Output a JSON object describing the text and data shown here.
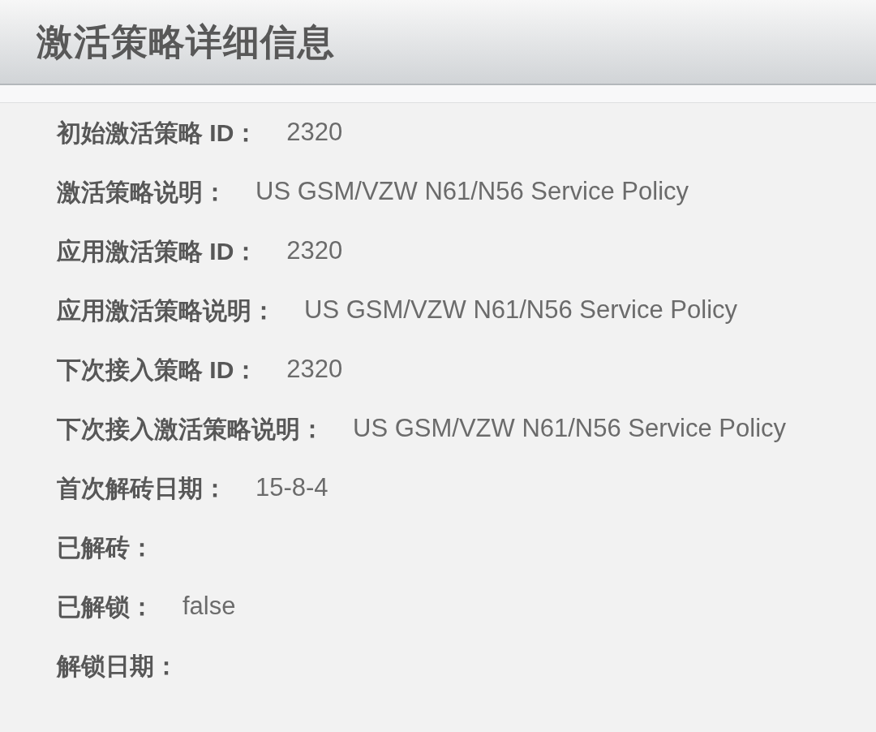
{
  "title": "激活策略详细信息",
  "fields": [
    {
      "label": "初始激活策略 ID：",
      "value": "2320"
    },
    {
      "label": "激活策略说明：",
      "value": "US GSM/VZW N61/N56 Service Policy"
    },
    {
      "label": "应用激活策略 ID：",
      "value": "2320"
    },
    {
      "label": "应用激活策略说明：",
      "value": "US GSM/VZW N61/N56 Service Policy"
    },
    {
      "label": "下次接入策略 ID：",
      "value": "2320"
    },
    {
      "label": "下次接入激活策略说明：",
      "value": "US GSM/VZW N61/N56 Service Policy"
    },
    {
      "label": "首次解砖日期：",
      "value": "15-8-4"
    },
    {
      "label": "已解砖："
    },
    {
      "label": "已解锁：",
      "value": "false"
    },
    {
      "label": "解锁日期："
    }
  ]
}
